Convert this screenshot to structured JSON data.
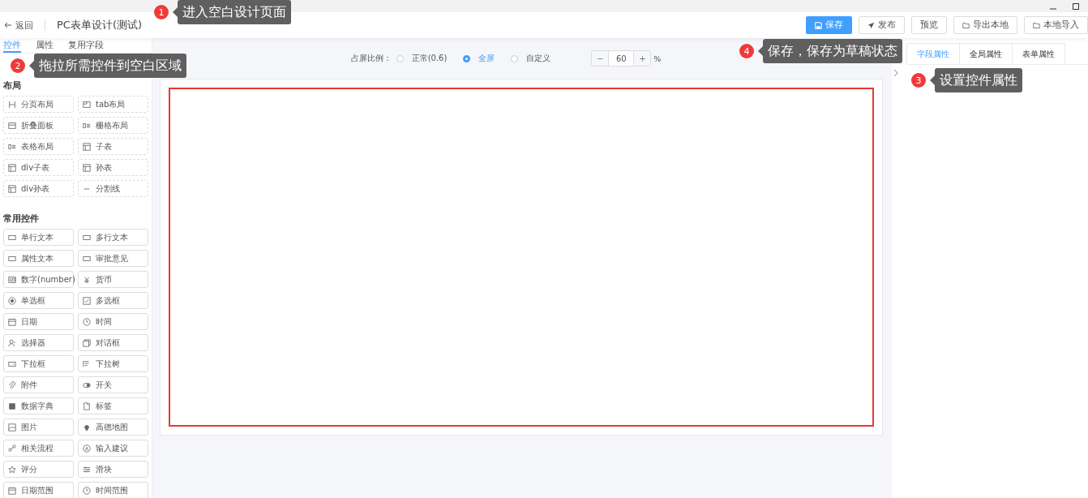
{
  "header": {
    "back": "返回",
    "title": "PC表单设计(测试)",
    "buttons": [
      {
        "label": "保存",
        "kind": "primary"
      },
      {
        "label": "发布",
        "kind": "send"
      },
      {
        "label": "预览",
        "kind": "plain"
      },
      {
        "label": "导出本地",
        "kind": "folder"
      },
      {
        "label": "本地导入",
        "kind": "folder"
      }
    ]
  },
  "left_tabs": [
    {
      "label": "控件",
      "selected": true
    },
    {
      "label": "属性",
      "selected": false
    },
    {
      "label": "复用字段",
      "selected": false
    }
  ],
  "sections": [
    {
      "title": "布局",
      "kind": "layout",
      "items": [
        "分页布局",
        "tab布局",
        "折叠面板",
        "栅格布局",
        "表格布局",
        "子表",
        "div子表",
        "孙表",
        "div孙表",
        "分割线"
      ]
    },
    {
      "title": "常用控件",
      "kind": "common",
      "items": [
        "单行文本",
        "多行文本",
        "属性文本",
        "审批意见",
        "数字(number)",
        "货币",
        "单选框",
        "多选框",
        "日期",
        "时间",
        "选择器",
        "对话框",
        "下拉框",
        "下拉树",
        "附件",
        "开关",
        "数据字典",
        "标签",
        "图片",
        "高德地图",
        "相关流程",
        "输入建议",
        "评分",
        "滑块",
        "日期范围",
        "时间范围"
      ]
    }
  ],
  "ratio": {
    "label": "占屏比例：",
    "options": [
      {
        "label": "正常(0.6)",
        "selected": false
      },
      {
        "label": "全屏",
        "selected": true
      },
      {
        "label": "自定义",
        "selected": false
      }
    ],
    "minus": "−",
    "value": "60",
    "plus": "+",
    "unit": "%"
  },
  "right_tabs": [
    {
      "label": "字段属性",
      "selected": true
    },
    {
      "label": "全局属性",
      "selected": false
    },
    {
      "label": "表单属性",
      "selected": false
    }
  ],
  "callouts": [
    {
      "number": "1",
      "text": "进入空白设计页面"
    },
    {
      "number": "2",
      "text": "拖拉所需控件到空白区域"
    },
    {
      "number": "3",
      "text": "设置控件属性"
    },
    {
      "number": "4",
      "text": "保存，保存为草稿状态"
    }
  ]
}
